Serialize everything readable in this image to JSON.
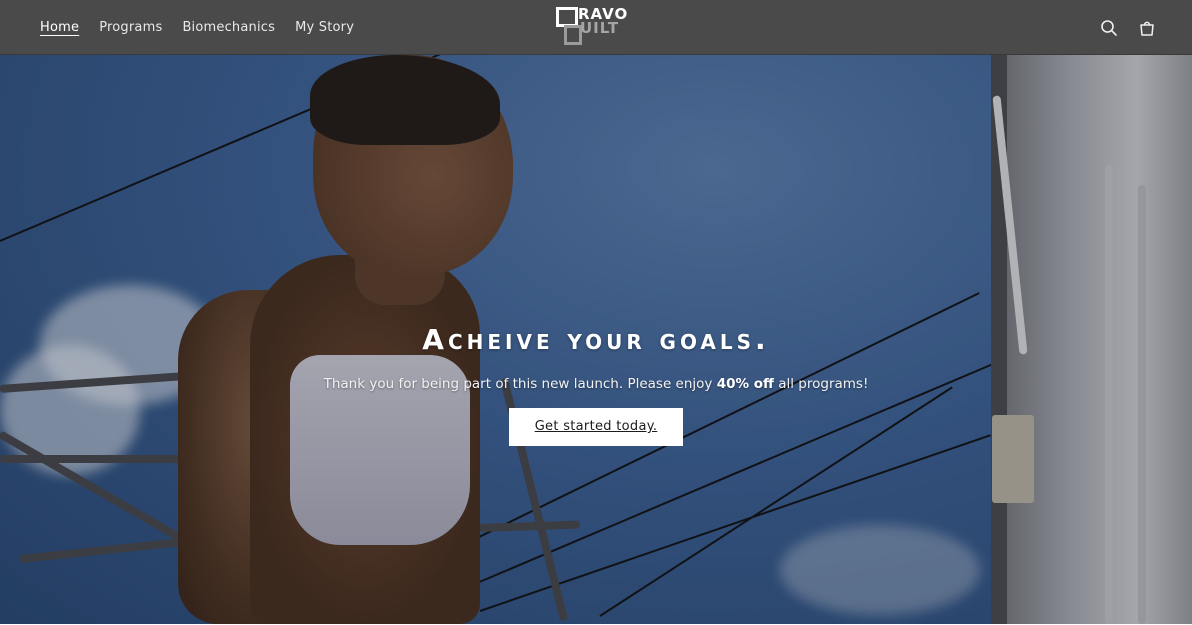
{
  "header": {
    "nav": [
      {
        "label": "Home",
        "active": true
      },
      {
        "label": "Programs",
        "active": false
      },
      {
        "label": "Biomechanics",
        "active": false
      },
      {
        "label": "My Story",
        "active": false
      }
    ],
    "logo": {
      "top": "RAVO",
      "bottom": "UILT",
      "letter": "B"
    },
    "icons": [
      "search-icon",
      "cart-icon"
    ]
  },
  "hero": {
    "title": "Acheive your goals.",
    "subtitle_before": "Thank you for being part of this new launch. Please enjoy ",
    "subtitle_bold": "40% off",
    "subtitle_after": " all programs!",
    "cta_label": "Get started today."
  },
  "colors": {
    "header_bg": "#4a4a4a",
    "cta_bg": "#ffffff",
    "text_light": "#ffffff"
  }
}
